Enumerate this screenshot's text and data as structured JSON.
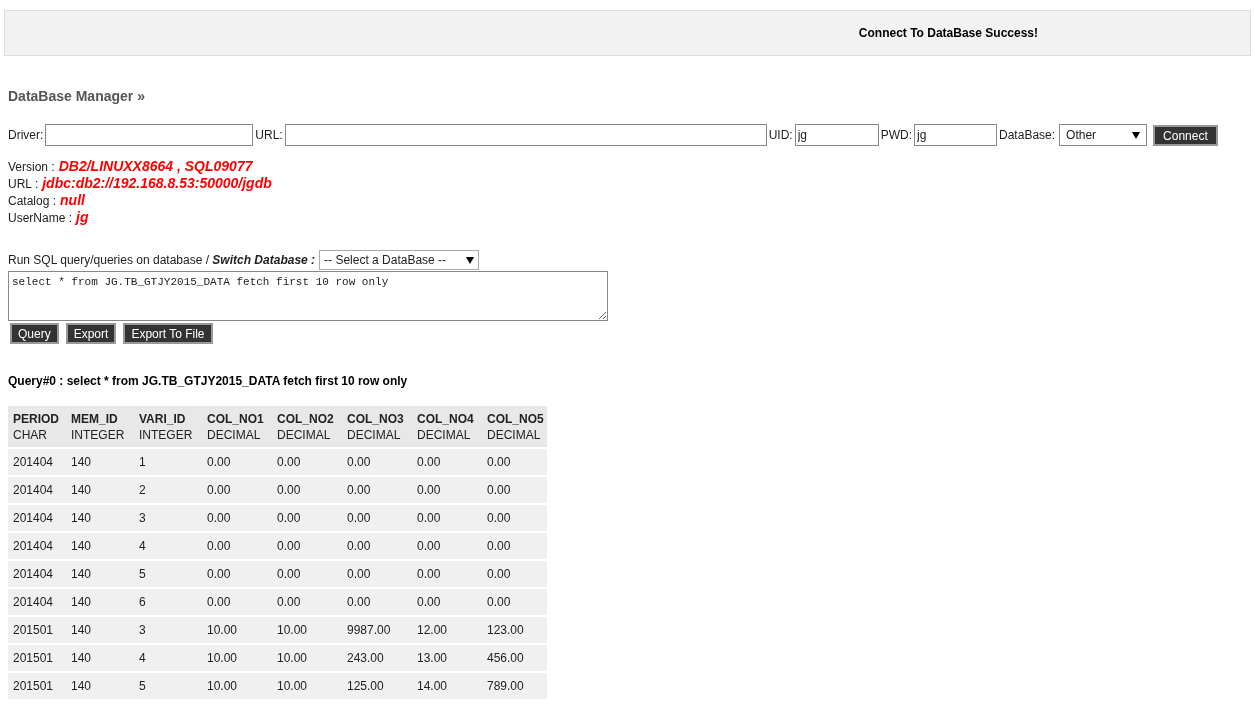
{
  "header": {
    "message": "Connect To DataBase Success!"
  },
  "title": "DataBase Manager »",
  "connect_form": {
    "driver_label": "Driver:",
    "url_label": "URL:",
    "uid_label": "UID:",
    "uid_value": "jg",
    "pwd_label": "PWD:",
    "pwd_value": "jg",
    "database_label": "DataBase:",
    "database_value": "Other",
    "connect_button": "Connect"
  },
  "info": [
    {
      "label": "Version :",
      "value": "DB2/LINUXX8664 , SQL09077"
    },
    {
      "label": "URL :",
      "value": "jdbc:db2://192.168.8.53:50000/jgdb"
    },
    {
      "label": "Catalog :",
      "value": "null"
    },
    {
      "label": "UserName :",
      "value": "jg"
    }
  ],
  "query_form": {
    "label": "Run SQL query/queries on database / **Switch Database :**",
    "switch_value": "-- Select a DataBase --",
    "sql": "select * from JG.TB_GTJY2015_DATA fetch first 10 row only",
    "buttons": [
      "Query",
      "Export",
      "Export To File"
    ]
  },
  "result_title": "Query#0 : select * from JG.TB_GTJY2015_DATA fetch first 10 row only",
  "table": {
    "columns": [
      {
        "name": "PERIOD",
        "type": "CHAR"
      },
      {
        "name": "MEM_ID",
        "type": "INTEGER"
      },
      {
        "name": "VARI_ID",
        "type": "INTEGER"
      },
      {
        "name": "COL_NO1",
        "type": "DECIMAL"
      },
      {
        "name": "COL_NO2",
        "type": "DECIMAL"
      },
      {
        "name": "COL_NO3",
        "type": "DECIMAL"
      },
      {
        "name": "COL_NO4",
        "type": "DECIMAL"
      },
      {
        "name": "COL_NO5",
        "type": "DECIMAL"
      }
    ],
    "rows": [
      [
        "201404",
        "140",
        "1",
        "0.00",
        "0.00",
        "0.00",
        "0.00",
        "0.00"
      ],
      [
        "201404",
        "140",
        "2",
        "0.00",
        "0.00",
        "0.00",
        "0.00",
        "0.00"
      ],
      [
        "201404",
        "140",
        "3",
        "0.00",
        "0.00",
        "0.00",
        "0.00",
        "0.00"
      ],
      [
        "201404",
        "140",
        "4",
        "0.00",
        "0.00",
        "0.00",
        "0.00",
        "0.00"
      ],
      [
        "201404",
        "140",
        "5",
        "0.00",
        "0.00",
        "0.00",
        "0.00",
        "0.00"
      ],
      [
        "201404",
        "140",
        "6",
        "0.00",
        "0.00",
        "0.00",
        "0.00",
        "0.00"
      ],
      [
        "201501",
        "140",
        "3",
        "10.00",
        "10.00",
        "9987.00",
        "12.00",
        "123.00"
      ],
      [
        "201501",
        "140",
        "4",
        "10.00",
        "10.00",
        "243.00",
        "13.00",
        "456.00"
      ],
      [
        "201501",
        "140",
        "5",
        "10.00",
        "10.00",
        "125.00",
        "14.00",
        "789.00"
      ]
    ]
  }
}
